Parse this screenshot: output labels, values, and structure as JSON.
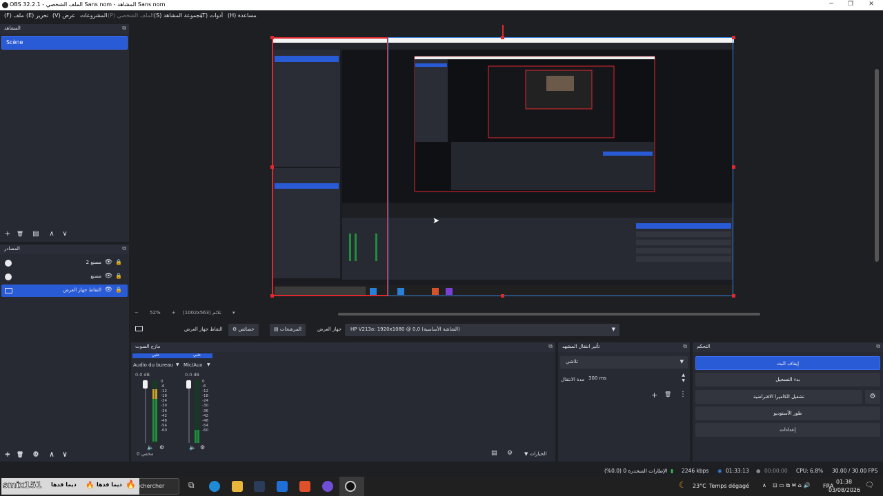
{
  "window": {
    "title": "OBS 32.2.1 - الملف الشخصي Sans nom - المشاهد Sans nom",
    "min": "─",
    "max": "❐",
    "close": "✕"
  },
  "menu": {
    "items": [
      "(F) ملف",
      "(E) تحرير",
      "(V) عرض",
      "المشروعات",
      "(P) الملف الشخصي",
      "(S) مجموعة المشاهد",
      "(T) أدوات",
      "(H) مساعدة"
    ]
  },
  "scenes": {
    "title": "المشاهد",
    "items": [
      "Scène"
    ],
    "toolbar": {
      "add": "+",
      "remove": "🗑",
      "filter": "▤",
      "up": "∧",
      "down": "∨"
    }
  },
  "sources": {
    "title": "المصادر",
    "items": [
      {
        "label": "مصنع 2",
        "type": "browser"
      },
      {
        "label": "مصنع",
        "type": "browser"
      },
      {
        "label": "التقاط جهاز العرض",
        "type": "display",
        "selected": true
      }
    ]
  },
  "preview": {
    "zoom_minus": "−",
    "zoom": "52%",
    "zoom_plus": "+",
    "resolution": "(1002x563) تلائم",
    "dropdown": "▾"
  },
  "context_bar": {
    "source_name": "التقاط جهاز العرض",
    "properties": "خصائص",
    "filters": "المرشحات",
    "display_label": "جهاز العرض",
    "display_value": "HP V213a: 1920x1080 @ 0,0 (الشاشة الأساسية)"
  },
  "mixer": {
    "title": "مازج الصوت",
    "channels": [
      {
        "name": "Audio du bureau",
        "header": "علبي",
        "db": "0.0 dB",
        "level": 0.0
      },
      {
        "name": "Mic/Aux",
        "header": "علبي",
        "db": "0.0 dB",
        "level": 0.55
      }
    ],
    "ticks": [
      "0",
      "-6",
      "-12",
      "-18",
      "-24",
      "-30",
      "-36",
      "-42",
      "-48",
      "-54",
      "-60"
    ],
    "footer_left": "0 مخفي",
    "footer_right": "الخيارات"
  },
  "transitions": {
    "title": "تأثير انتقال المشهد",
    "type": "تلاشي",
    "duration_label": "مدة الانتقال",
    "duration_value": "300 ms"
  },
  "controls": {
    "title": "التحكم",
    "buttons": [
      "إيقاف البث",
      "بدء التسجيل",
      "تشغيل الكاميرا الافتراضية",
      "طور الأستوديو",
      "إعدادات"
    ]
  },
  "status": {
    "dropped": "الإطارات المنحدرة 0 (0.0%)",
    "bitrate": "2246 kbps",
    "stream_time": "01:33:13",
    "rec_time": "00:00:00",
    "cpu": "CPU: 6.8%",
    "fps": "30.00 / 30.00 FPS"
  },
  "taskbar": {
    "search_placeholder": "Rechercher",
    "overlay_text": "smix151",
    "overlay_ar": "ديما قدها",
    "temp": "23°C",
    "weather": "Temps dégagé",
    "lang": "FRA",
    "time": "01:38",
    "date": "03/08/2026"
  }
}
